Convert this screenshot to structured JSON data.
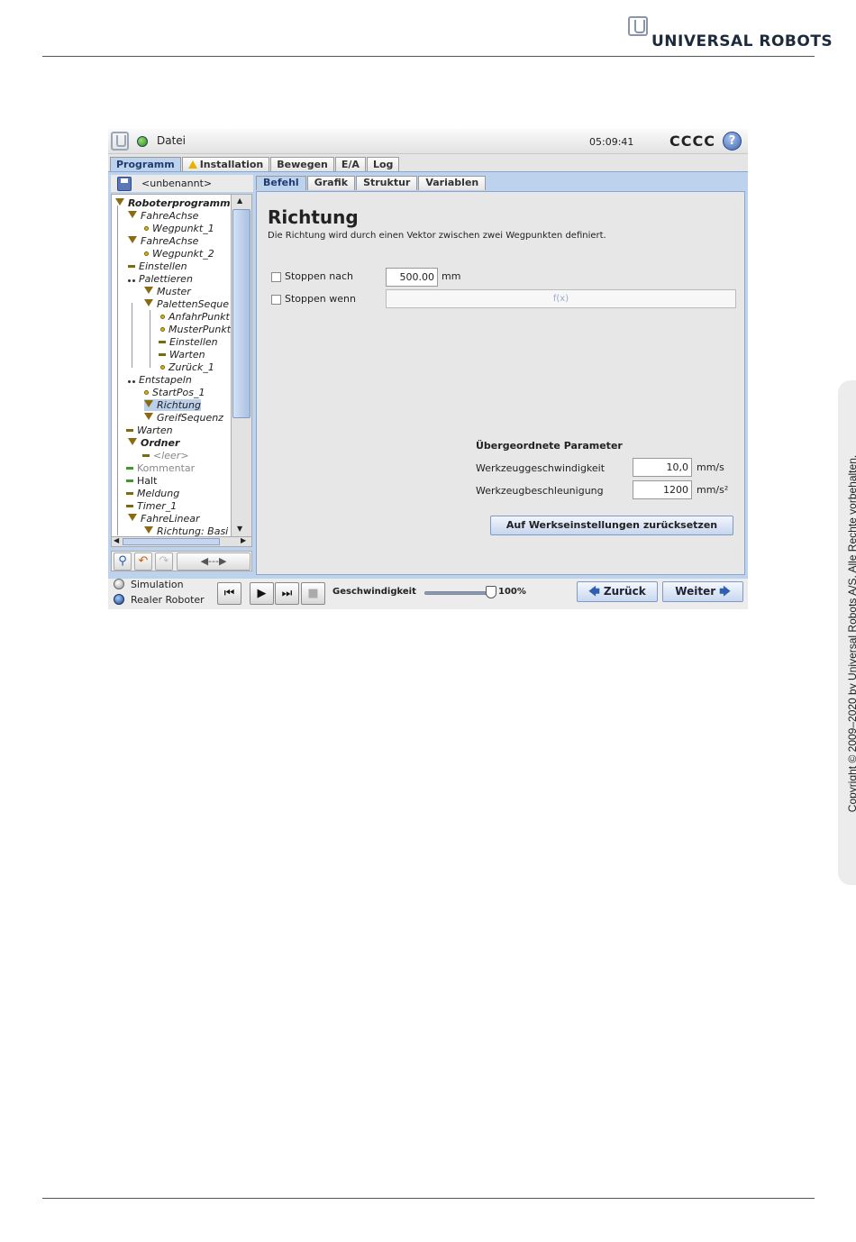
{
  "page": {
    "brand": "UNIVERSAL ROBOTS",
    "copyright": "Copyright © 2009–2020 by Universal Robots A/S. Alle Rechte vorbehalten."
  },
  "topbar": {
    "file_menu": "Datei",
    "time": "05:09:41",
    "robot_name": "CCCC",
    "help_glyph": "?"
  },
  "main_tabs": [
    "Programm",
    "Installation",
    "Bewegen",
    "E/A",
    "Log"
  ],
  "program": {
    "name": "<unbenannt>",
    "tree": [
      {
        "label": "Roboterprogramm",
        "icon": "move-icon"
      },
      {
        "label": "FahreAchse",
        "icon": "move-icon"
      },
      {
        "label": "Wegpunkt_1",
        "icon": "waypoint-icon"
      },
      {
        "label": "FahreAchse",
        "icon": "move-icon"
      },
      {
        "label": "Wegpunkt_2",
        "icon": "waypoint-icon"
      },
      {
        "label": "Einstellen",
        "icon": "set-icon"
      },
      {
        "label": "Palettieren",
        "icon": "pallet-icon"
      },
      {
        "label": "Muster",
        "icon": "pattern-icon"
      },
      {
        "label": "PalettenSeque",
        "icon": "sequence-icon"
      },
      {
        "label": "AnfahrPunkt",
        "icon": "waypoint-icon"
      },
      {
        "label": "MusterPunkt",
        "icon": "waypoint-icon"
      },
      {
        "label": "Einstellen",
        "icon": "set-icon"
      },
      {
        "label": "Warten",
        "icon": "wait-icon"
      },
      {
        "label": "Zurück_1",
        "icon": "waypoint-icon"
      },
      {
        "label": "Entstapeln",
        "icon": "pallet-icon"
      },
      {
        "label": "StartPos_1",
        "icon": "waypoint-icon"
      },
      {
        "label": "Richtung",
        "icon": "direction-icon"
      },
      {
        "label": "GreifSequenz",
        "icon": "sequence-icon"
      },
      {
        "label": "Warten",
        "icon": "wait-icon"
      },
      {
        "label": "Ordner",
        "icon": "folder-icon"
      },
      {
        "label": "<leer>",
        "icon": "empty-icon"
      },
      {
        "label": "Kommentar",
        "icon": "comment-icon"
      },
      {
        "label": "Halt",
        "icon": "halt-icon"
      },
      {
        "label": "Meldung",
        "icon": "popup-icon"
      },
      {
        "label": "Timer_1",
        "icon": "timer-icon"
      },
      {
        "label": "FahreLinear",
        "icon": "move-icon"
      },
      {
        "label": "Richtung: Basi",
        "icon": "direction-icon"
      }
    ]
  },
  "sub_tabs": [
    "Befehl",
    "Grafik",
    "Struktur",
    "Variablen"
  ],
  "command": {
    "title": "Richtung",
    "description": "Die Richtung wird durch einen Vektor zwischen zwei Wegpunkten definiert.",
    "stop_after_label": "Stoppen nach",
    "stop_after_value": "500.00",
    "stop_after_unit": "mm",
    "stop_when_label": "Stoppen wenn",
    "stop_when_placeholder": "f(x)",
    "params_title": "Übergeordnete Parameter",
    "tool_speed_label": "Werkzeuggeschwindigkeit",
    "tool_speed_value": "10,0",
    "tool_speed_unit": "mm/s",
    "tool_accel_label": "Werkzeugbeschleunigung",
    "tool_accel_value": "1200",
    "tool_accel_unit": "mm/s²",
    "reset_button": "Auf Werkseinstellungen zurücksetzen"
  },
  "bottom": {
    "simulation": "Simulation",
    "real_robot": "Realer Roboter",
    "speed_label": "Geschwindigkeit",
    "speed_value": "100%",
    "speed_fraction": 1.0,
    "back": "Zurück",
    "next": "Weiter"
  }
}
